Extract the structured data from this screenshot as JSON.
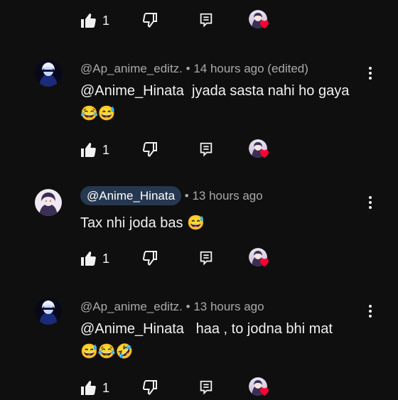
{
  "colors": {
    "background": "#0f0f0f",
    "text": "#f1f1f1",
    "meta": "#aaaaaa",
    "chip": "#263850",
    "heart": "#ff0033"
  },
  "rows": [
    {
      "like_count": "1"
    },
    {
      "like_count": "1"
    },
    {
      "like_count": "1"
    },
    {
      "like_count": "1"
    }
  ],
  "comments": [
    {
      "author": "@Ap_anime_editz.",
      "time": "• 14 hours ago (edited)",
      "mention": "@Anime_Hinata",
      "body": "  jyada sasta nahi ho gaya",
      "emoji": "😂😅"
    },
    {
      "author": "@Anime_Hinata",
      "time": "• 13 hours ago",
      "body": "Tax nhi joda bas ",
      "emoji": "😅"
    },
    {
      "author": "@Ap_anime_editz.",
      "time": "• 13 hours ago",
      "mention": "@Anime_Hinata",
      "body": "   haa , to jodna bhi mat",
      "emoji": "😅😂🤣"
    }
  ],
  "icons": {
    "like": "thumbs-up-icon",
    "dislike": "thumbs-down-icon",
    "reply": "reply-icon",
    "more": "more-vert-icon",
    "heart": "heart-icon"
  }
}
